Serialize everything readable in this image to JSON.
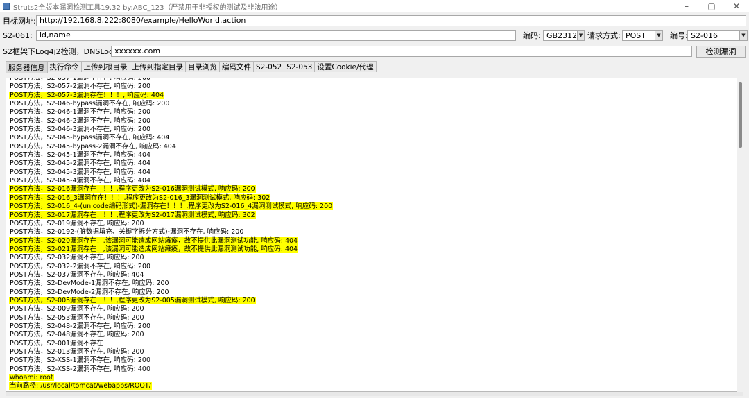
{
  "window": {
    "title": "Struts2全版本漏洞检测工具19.32 by:ABC_123（严禁用于非授权的测试及非法用途）",
    "minimize_glyph": "–",
    "restore_glyph": "▢",
    "close_glyph": "✕"
  },
  "target": {
    "label": "目标网址:",
    "value": "http://192.168.8.222:8080/example/HelloWorld.action"
  },
  "params": {
    "label": "S2-061:",
    "value": "id,name",
    "encoding_label": "编码:",
    "encoding_value": "GB2312",
    "method_label": "请求方式:",
    "method_value": "POST",
    "number_label": "编号:",
    "number_value": "S2-016"
  },
  "dnslog": {
    "label": "S2框架下Log4j2检测，DNSLog地址:",
    "value": "xxxxxx.com",
    "detect_button": "检测漏洞"
  },
  "tabs": [
    "服务器信息",
    "执行命令",
    "上传到根目录",
    "上传到指定目录",
    "目录浏览",
    "编码文件",
    "S2-052",
    "S2-053",
    "设置Cookie/代理"
  ],
  "log_lines": [
    {
      "text": "POST方法，S2-057-1漏洞不存在, 响应码: 200",
      "highlight": false
    },
    {
      "text": "POST方法，S2-057-2漏洞不存在, 响应码: 200",
      "highlight": false
    },
    {
      "text": "POST方法，S2-057-3漏洞存在！！！, 响应码: 404",
      "highlight": true
    },
    {
      "text": "POST方法，S2-046-bypass漏洞不存在, 响应码: 200",
      "highlight": false
    },
    {
      "text": "POST方法，S2-046-1漏洞不存在, 响应码: 200",
      "highlight": false
    },
    {
      "text": "POST方法，S2-046-2漏洞不存在, 响应码: 200",
      "highlight": false
    },
    {
      "text": "POST方法，S2-046-3漏洞不存在, 响应码: 200",
      "highlight": false
    },
    {
      "text": "POST方法，S2-045-bypass漏洞不存在, 响应码: 404",
      "highlight": false
    },
    {
      "text": "POST方法，S2-045-bypass-2漏洞不存在, 响应码: 404",
      "highlight": false
    },
    {
      "text": "POST方法，S2-045-1漏洞不存在, 响应码: 404",
      "highlight": false
    },
    {
      "text": "POST方法，S2-045-2漏洞不存在, 响应码: 404",
      "highlight": false
    },
    {
      "text": "POST方法，S2-045-3漏洞不存在, 响应码: 404",
      "highlight": false
    },
    {
      "text": "POST方法，S2-045-4漏洞不存在, 响应码: 404",
      "highlight": false
    },
    {
      "text": "POST方法，S2-016漏洞存在！！！,程序更改为S2-016漏洞测试模式, 响应码: 200",
      "highlight": true
    },
    {
      "text": "POST方法，S2-016_3漏洞存在！！！,程序更改为S2-016_3漏洞测试模式, 响应码: 302",
      "highlight": true
    },
    {
      "text": "POST方法，S2-016_4-(unicode编码形式)-漏洞存在！！！,程序更改为S2-016_4漏洞测试模式, 响应码: 200",
      "highlight": true
    },
    {
      "text": "POST方法，S2-017漏洞存在！！！,程序更改为S2-017漏洞测试模式, 响应码: 302",
      "highlight": true
    },
    {
      "text": "POST方法，S2-019漏洞不存在, 响应码: 200",
      "highlight": false
    },
    {
      "text": "POST方法，S2-0192-(脏数据填充、关键字拆分方式)-漏洞不存在, 响应码: 200",
      "highlight": false
    },
    {
      "text": "POST方法，S2-020漏洞存在！,该漏洞可能造成网站瘫痪，故不提供此漏洞测试功能, 响应码: 404",
      "highlight": true
    },
    {
      "text": "POST方法，S2-021漏洞存在！,该漏洞可能造成网站瘫痪，故不提供此漏洞测试功能, 响应码: 404",
      "highlight": true
    },
    {
      "text": "POST方法，S2-032漏洞不存在, 响应码: 200",
      "highlight": false
    },
    {
      "text": "POST方法，S2-032-2漏洞不存在, 响应码: 200",
      "highlight": false
    },
    {
      "text": "POST方法，S2-037漏洞不存在, 响应码: 404",
      "highlight": false
    },
    {
      "text": "POST方法，S2-DevMode-1漏洞不存在, 响应码: 200",
      "highlight": false
    },
    {
      "text": "POST方法，S2-DevMode-2漏洞不存在, 响应码: 200",
      "highlight": false
    },
    {
      "text": "POST方法，S2-005漏洞存在！！！,程序更改为S2-005漏洞测试模式, 响应码: 200",
      "highlight": true
    },
    {
      "text": "POST方法，S2-009漏洞不存在, 响应码: 200",
      "highlight": false
    },
    {
      "text": "POST方法，S2-053漏洞不存在, 响应码: 200",
      "highlight": false
    },
    {
      "text": "POST方法，S2-048-2漏洞不存在, 响应码: 200",
      "highlight": false
    },
    {
      "text": "POST方法，S2-048漏洞不存在, 响应码: 200",
      "highlight": false
    },
    {
      "text": "POST方法，S2-001漏洞不存在",
      "highlight": false
    },
    {
      "text": "POST方法，S2-013漏洞不存在, 响应码: 200",
      "highlight": false
    },
    {
      "text": "POST方法，S2-XSS-1漏洞不存在, 响应码: 200",
      "highlight": false
    },
    {
      "text": "POST方法，S2-XSS-2漏洞不存在, 响应码: 400",
      "highlight": false
    },
    {
      "text": "whoami:  root",
      "highlight": true
    },
    {
      "text": "当前路径:  /usr/local/tomcat/webapps/ROOT/",
      "highlight": true
    }
  ]
}
